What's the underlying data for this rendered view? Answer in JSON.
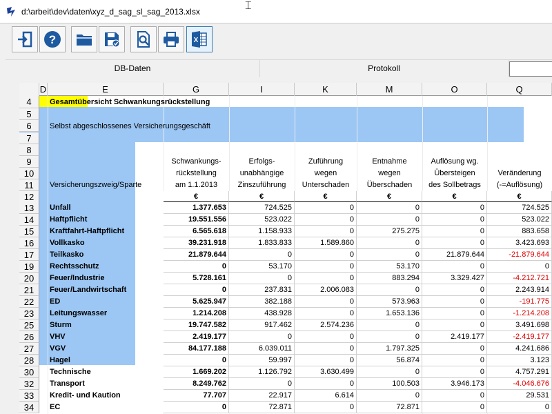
{
  "window": {
    "title": "d:\\arbeit\\dev\\daten\\xyz_d_sag_sl_sag_2013.xlsx"
  },
  "toolbar": {
    "buttons": [
      {
        "name": "exit-button",
        "icon": "exit-door-icon"
      },
      {
        "name": "help-button",
        "icon": "help-icon"
      },
      {
        "name": "open-button",
        "icon": "folder-icon"
      },
      {
        "name": "save-button",
        "icon": "save-icon"
      },
      {
        "name": "preview-button",
        "icon": "print-preview-icon"
      },
      {
        "name": "print-button",
        "icon": "printer-icon"
      },
      {
        "name": "excel-button",
        "icon": "excel-icon"
      }
    ]
  },
  "tabs": [
    "DB-Daten",
    "Protokoll"
  ],
  "columns": [
    "D",
    "E",
    "G",
    "I",
    "K",
    "M",
    "O",
    "Q"
  ],
  "sheet": {
    "heading": "Gesamtübersicht Schwankungsrückstellung",
    "subheading": "Selbst abgeschlossenes Versicherungsgeschäft",
    "header_row9": [
      "Schwankungs-",
      "Erfolgs-",
      "Zuführung",
      "Entnahme",
      "Auflösung wg.",
      ""
    ],
    "header_row10": [
      "rückstellung",
      "unabhängige",
      "wegen",
      "wegen",
      "Übersteigen",
      "Veränderung"
    ],
    "header_row11": [
      "Versicherungszweig/Sparte",
      "am 1.1.2013",
      "Zinszuführung",
      "Unterschaden",
      "Überschaden",
      "des Sollbetrags",
      "(-=Auflösung)"
    ],
    "currency": "€",
    "row_numbers": [
      "4",
      "5",
      "6",
      "7",
      "8",
      "9",
      "10",
      "11",
      "12",
      "13",
      "14",
      "15",
      "16",
      "17",
      "19",
      "20",
      "21",
      "22",
      "23",
      "25",
      "26",
      "27",
      "28",
      "30",
      "32",
      "33",
      "34"
    ],
    "rows": [
      {
        "rn": "13",
        "name": "Unfall",
        "g": "1.377.653",
        "i": "724.525",
        "k": "0",
        "m": "0",
        "o": "0",
        "q": "724.525",
        "neg": false
      },
      {
        "rn": "14",
        "name": "Haftpflicht",
        "g": "19.551.556",
        "i": "523.022",
        "k": "0",
        "m": "0",
        "o": "0",
        "q": "523.022",
        "neg": false
      },
      {
        "rn": "15",
        "name": "Kraftfahrt-Haftpflicht",
        "g": "6.565.618",
        "i": "1.158.933",
        "k": "0",
        "m": "275.275",
        "o": "0",
        "q": "883.658",
        "neg": false
      },
      {
        "rn": "16",
        "name": "Vollkasko",
        "g": "39.231.918",
        "i": "1.833.833",
        "k": "1.589.860",
        "m": "0",
        "o": "0",
        "q": "3.423.693",
        "neg": false
      },
      {
        "rn": "17",
        "name": "Teilkasko",
        "g": "21.879.644",
        "i": "0",
        "k": "0",
        "m": "0",
        "o": "21.879.644",
        "q": "-21.879.644",
        "neg": true
      },
      {
        "rn": "19",
        "name": "Rechtsschutz",
        "g": "0",
        "i": "53.170",
        "k": "0",
        "m": "53.170",
        "o": "0",
        "q": "0",
        "neg": false
      },
      {
        "rn": "20",
        "name": "Feuer/Industrie",
        "g": "5.728.161",
        "i": "0",
        "k": "0",
        "m": "883.294",
        "o": "3.329.427",
        "q": "-4.212.721",
        "neg": true
      },
      {
        "rn": "21",
        "name": "Feuer/Landwirtschaft",
        "g": "0",
        "i": "237.831",
        "k": "2.006.083",
        "m": "0",
        "o": "0",
        "q": "2.243.914",
        "neg": false
      },
      {
        "rn": "22",
        "name": "ED",
        "g": "5.625.947",
        "i": "382.188",
        "k": "0",
        "m": "573.963",
        "o": "0",
        "q": "-191.775",
        "neg": true
      },
      {
        "rn": "23",
        "name": "Leitungswasser",
        "g": "1.214.208",
        "i": "438.928",
        "k": "0",
        "m": "1.653.136",
        "o": "0",
        "q": "-1.214.208",
        "neg": true
      },
      {
        "rn": "25",
        "name": "Sturm",
        "g": "19.747.582",
        "i": "917.462",
        "k": "2.574.236",
        "m": "0",
        "o": "0",
        "q": "3.491.698",
        "neg": false
      },
      {
        "rn": "26",
        "name": "VHV",
        "g": "2.419.177",
        "i": "0",
        "k": "0",
        "m": "0",
        "o": "2.419.177",
        "q": "-2.419.177",
        "neg": true
      },
      {
        "rn": "27",
        "name": "VGV",
        "g": "84.177.188",
        "i": "6.039.011",
        "k": "0",
        "m": "1.797.325",
        "o": "0",
        "q": "4.241.686",
        "neg": false
      },
      {
        "rn": "28",
        "name": "Hagel",
        "g": "0",
        "i": "59.997",
        "k": "0",
        "m": "56.874",
        "o": "0",
        "q": "3.123",
        "neg": false
      },
      {
        "rn": "30",
        "name": "Technische",
        "g": "1.669.202",
        "i": "1.126.792",
        "k": "3.630.499",
        "m": "0",
        "o": "0",
        "q": "4.757.291",
        "neg": false
      },
      {
        "rn": "32",
        "name": "Transport",
        "g": "8.249.762",
        "i": "0",
        "k": "0",
        "m": "100.503",
        "o": "3.946.173",
        "q": "-4.046.676",
        "neg": true
      },
      {
        "rn": "33",
        "name": "Kredit- und Kaution",
        "g": "77.707",
        "i": "22.917",
        "k": "6.614",
        "m": "0",
        "o": "0",
        "q": "29.531",
        "neg": false
      },
      {
        "rn": "34",
        "name": "EC",
        "g": "0",
        "i": "72.871",
        "k": "0",
        "m": "72.871",
        "o": "0",
        "q": "0",
        "neg": false
      }
    ]
  }
}
